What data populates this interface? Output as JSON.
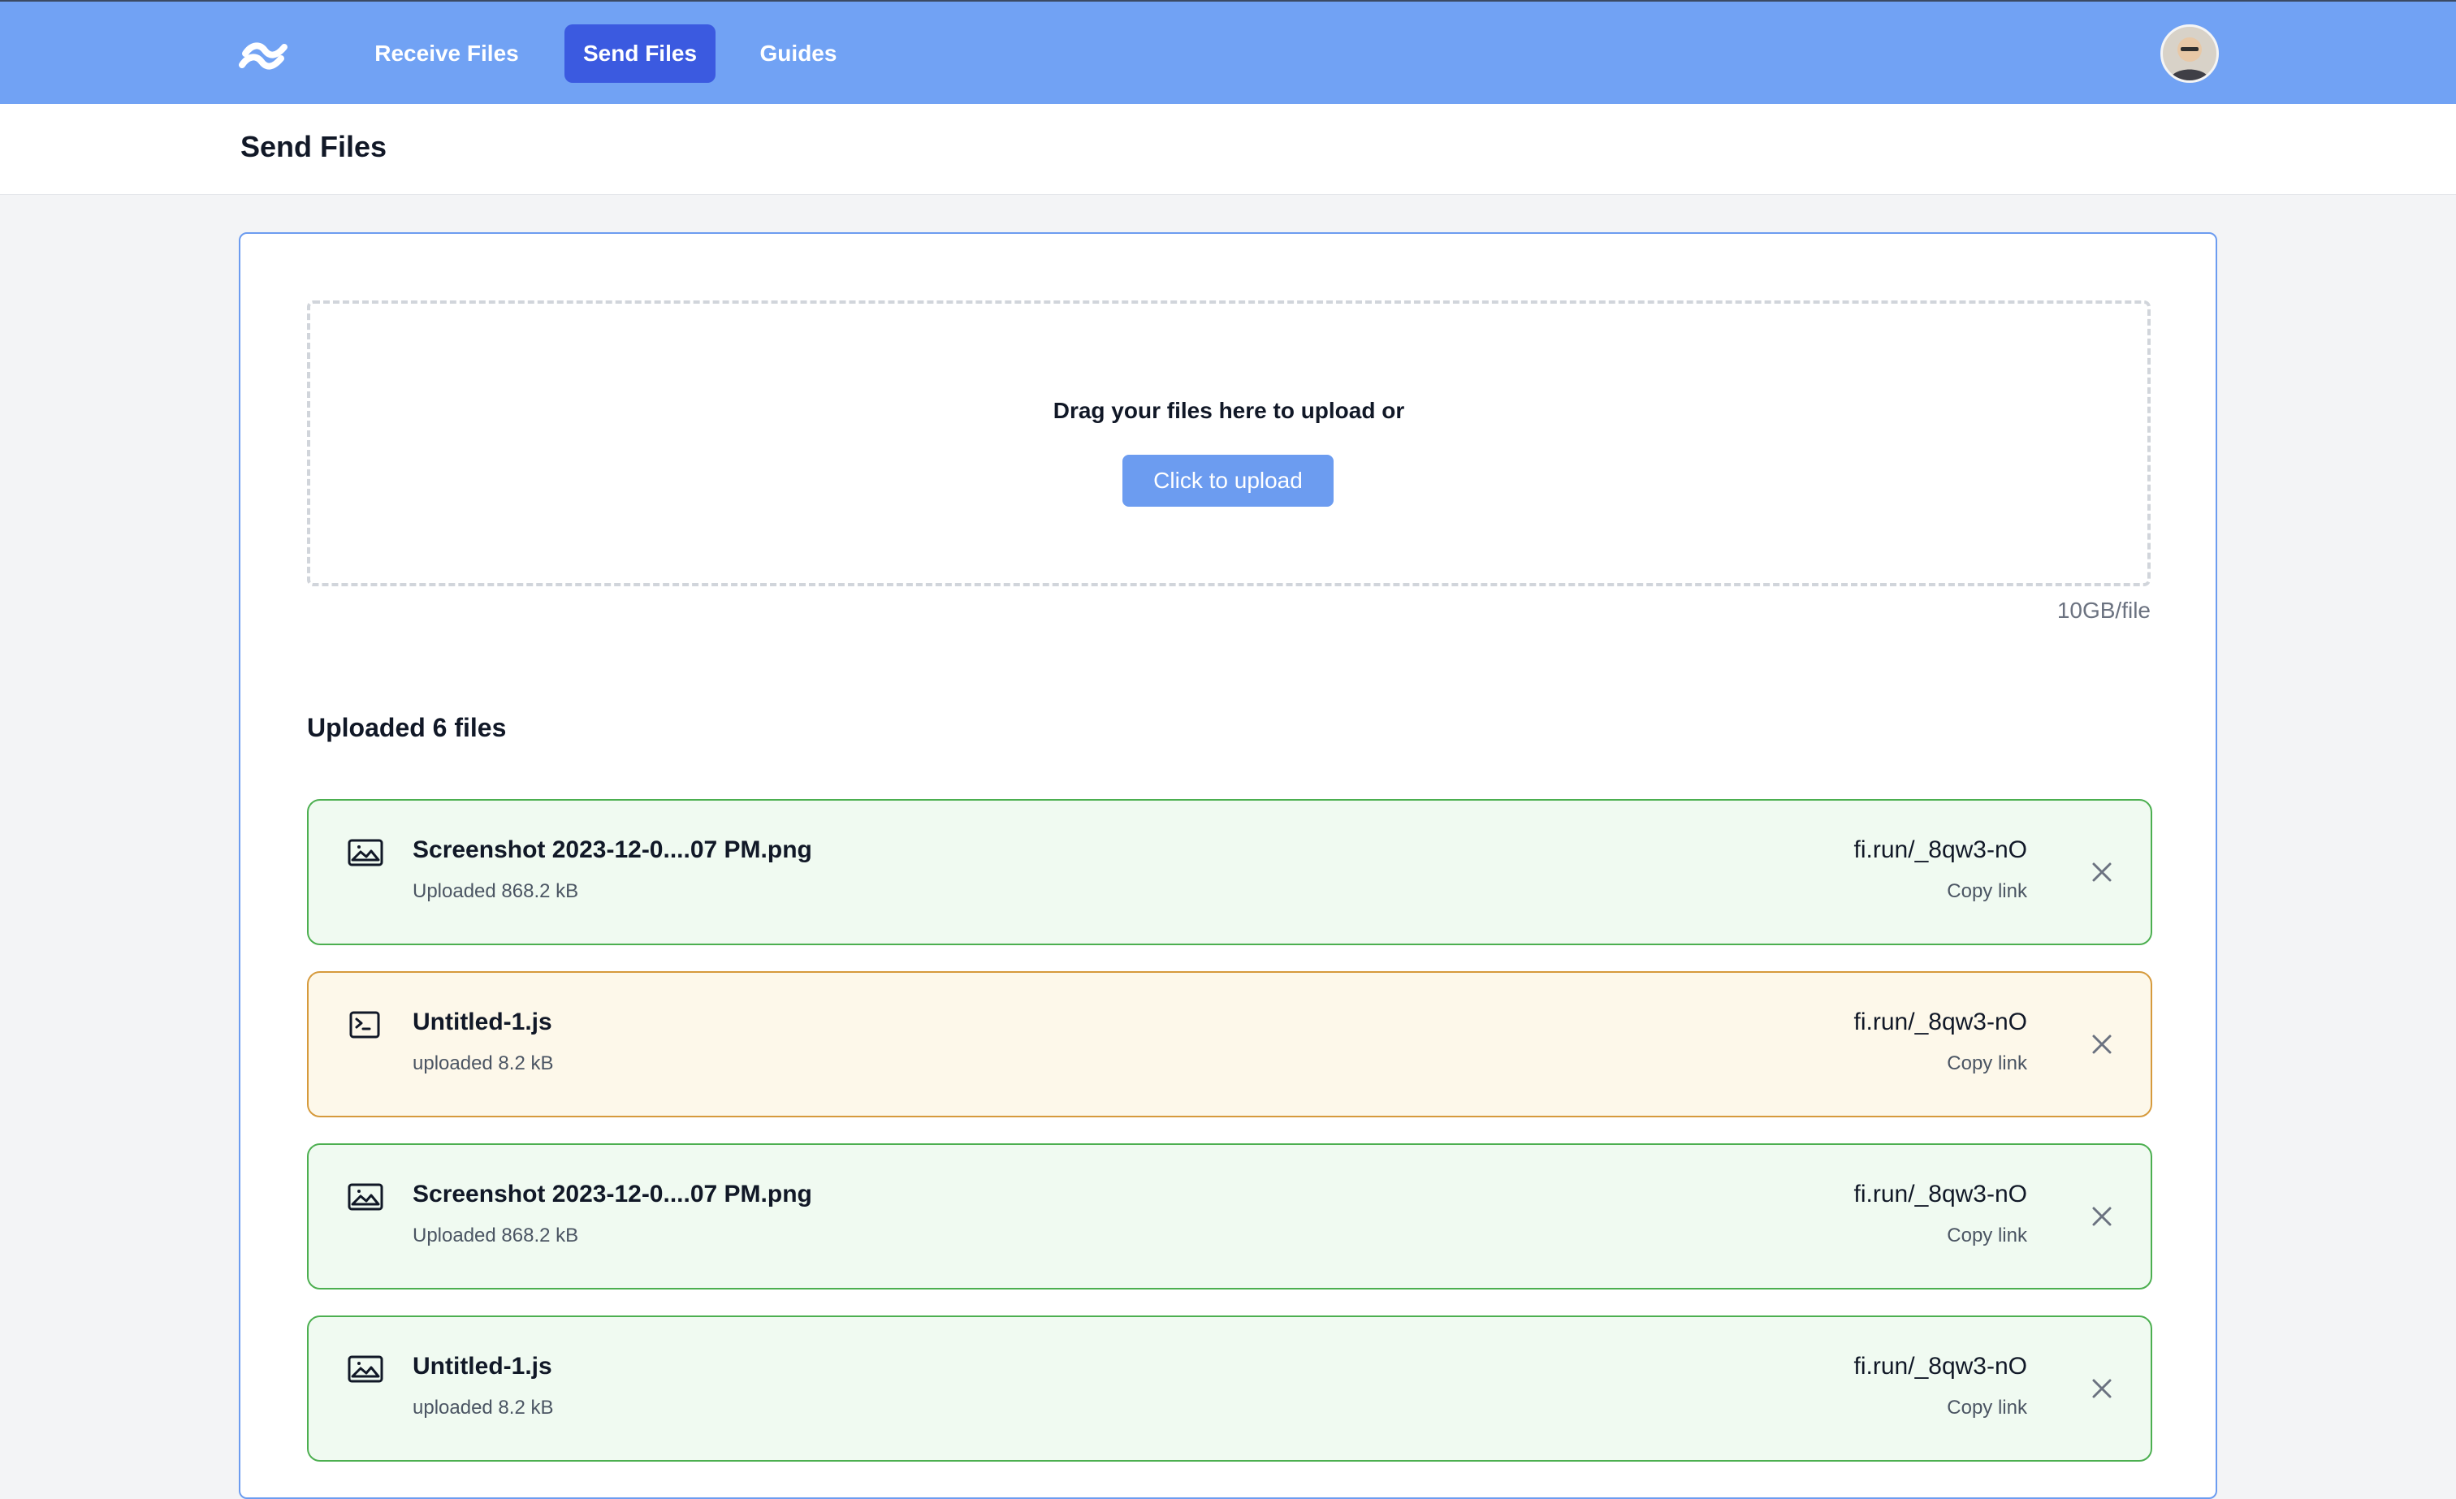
{
  "nav": {
    "logo": "wave-logo-icon",
    "items": [
      {
        "label": "Receive Files"
      },
      {
        "label": "Send Files"
      },
      {
        "label": "Guides"
      }
    ],
    "active_index": 1,
    "avatar": "user-avatar"
  },
  "page": {
    "title": "Send Files"
  },
  "upload": {
    "prompt": "Drag your files here to upload or",
    "button_label": "Click to upload",
    "limit": "10GB/file"
  },
  "uploaded": {
    "title": "Uploaded 6 files",
    "files": [
      {
        "name": "Screenshot 2023-12-0....07 PM.png",
        "status": "Uploaded 868.2 kB",
        "link": "fi.run/_8qw3-nO",
        "copy": "Copy link",
        "icon": "image-icon",
        "state": "success"
      },
      {
        "name": "Untitled-1.js",
        "status": "uploaded 8.2 kB",
        "link": "fi.run/_8qw3-nO",
        "copy": "Copy link",
        "icon": "terminal-icon",
        "state": "warning"
      },
      {
        "name": "Screenshot 2023-12-0....07 PM.png",
        "status": "Uploaded 868.2 kB",
        "link": "fi.run/_8qw3-nO",
        "copy": "Copy link",
        "icon": "image-icon",
        "state": "success"
      },
      {
        "name": "Untitled-1.js",
        "status": "uploaded 8.2 kB",
        "link": "fi.run/_8qw3-nO",
        "copy": "Copy link",
        "icon": "image-icon",
        "state": "success"
      }
    ]
  },
  "colors": {
    "nav_bg": "#71a2f4",
    "nav_active": "#3b5ae0",
    "card_border": "#6c9cf0",
    "success_border": "#4caf50",
    "success_bg": "#f0faf1",
    "warning_border": "#d69a3c",
    "warning_bg": "#fdf8ea"
  }
}
